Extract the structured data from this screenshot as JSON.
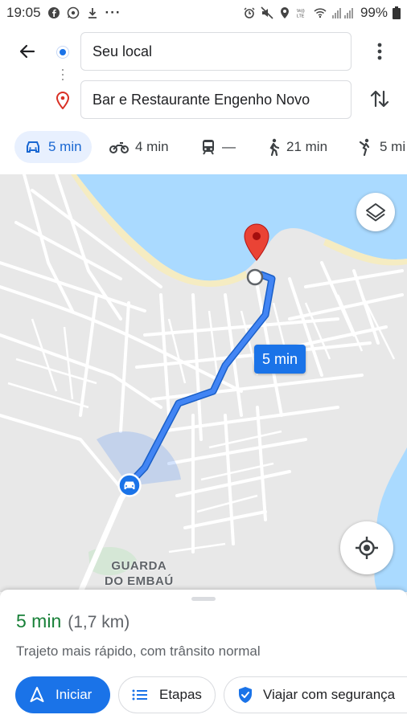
{
  "status_bar": {
    "time": "19:05",
    "more_indicator": "···",
    "battery": "99%",
    "left_icons": [
      "facebook-icon",
      "whatsapp-icon",
      "download-icon"
    ],
    "right_icons": [
      "alarm-icon",
      "mute-icon",
      "location-icon",
      "volte-icon",
      "wifi-icon",
      "signal-icon",
      "battery-icon"
    ]
  },
  "search": {
    "origin_value": "Seu local",
    "destination_value": "Bar e Restaurante Engenho Novo"
  },
  "modes": [
    {
      "id": "car",
      "label": "5 min",
      "icon": "car-icon",
      "active": true
    },
    {
      "id": "moto",
      "label": "4 min",
      "icon": "motorcycle-icon",
      "active": false
    },
    {
      "id": "transit",
      "label": "—",
      "icon": "transit-icon",
      "active": false
    },
    {
      "id": "walk",
      "label": "21 min",
      "icon": "walk-icon",
      "active": false
    },
    {
      "id": "ride",
      "label": "5 mi",
      "icon": "ride-icon",
      "active": false
    }
  ],
  "map": {
    "route_label": "5 min",
    "place_label_line1": "GUARDA",
    "place_label_line2": "DO EMBAÚ",
    "colors": {
      "water": "#aadaff",
      "land": "#e8e8e8",
      "roads": "#ffffff",
      "route": "#4285f4",
      "route_outline": "#1a5fc7",
      "pin": "#ea4335",
      "beach": "#f5ecc2"
    }
  },
  "sheet": {
    "eta_time": "5 min",
    "eta_distance": "(1,7 km)",
    "subtitle": "Trajeto mais rápido, com trânsito normal",
    "start_label": "Iniciar",
    "steps_label": "Etapas",
    "safety_label": "Viajar com segurança"
  }
}
